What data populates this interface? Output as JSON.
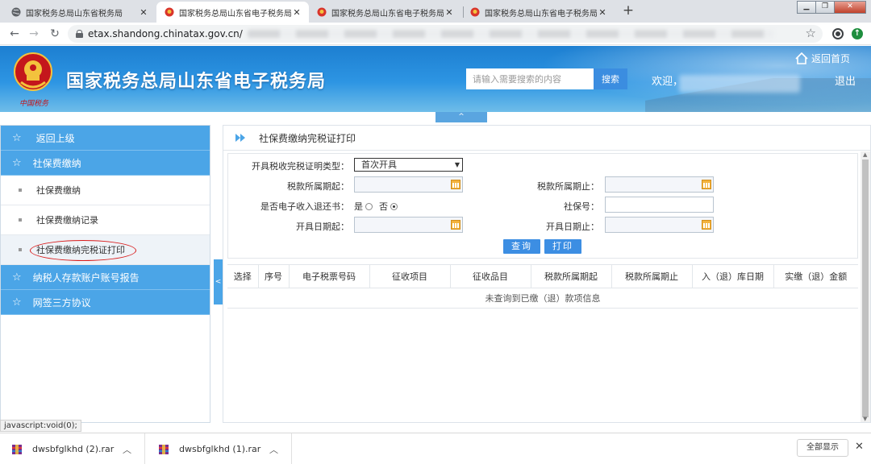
{
  "browser": {
    "tabs": [
      {
        "title": "国家税务总局山东省税务局",
        "active": false
      },
      {
        "title": "国家税务总局山东省电子税务局",
        "active": true
      },
      {
        "title": "国家税务总局山东省电子税务局",
        "active": false
      },
      {
        "title": "国家税务总局山东省电子税务局",
        "active": false
      }
    ],
    "url": "etax.shandong.chinatax.gov.cn/",
    "status_text": "javascript:void(0);"
  },
  "header": {
    "site_title": "国家税务总局山东省电子税务局",
    "emblem_text": "中国税务",
    "search_placeholder": "请输入需要搜索的内容",
    "search_button": "搜索",
    "welcome": "欢迎，",
    "home_link": "返回首页",
    "logout": "退出",
    "collapse_arrow": "^"
  },
  "sidebar": {
    "back": "返回上级",
    "groups": [
      {
        "label": "社保费缴纳",
        "items": [
          "社保费缴纳",
          "社保费缴纳记录",
          "社保费缴纳完税证打印"
        ]
      },
      {
        "label": "纳税人存款账户账号报告"
      },
      {
        "label": "网签三方协议"
      }
    ],
    "selected_item": "社保费缴纳完税证打印",
    "toggle_arrow": "<"
  },
  "main": {
    "page_title": "社保费缴纳完税证打印",
    "form": {
      "cert_type_label": "开具税收完税证明类型：",
      "cert_type_value": "首次开具",
      "tax_period_start_label": "税款所属期起：",
      "tax_period_end_label": "税款所属期止：",
      "e_refund_label": "是否电子收入退还书：",
      "yes_label": "是",
      "no_label": "否",
      "e_refund_selected": "否",
      "social_security_no_label": "社保号：",
      "issue_date_start_label": "开具日期起：",
      "issue_date_end_label": "开具日期止：",
      "query_button": "查询",
      "print_button": "打印"
    },
    "table": {
      "columns": [
        "选择",
        "序号",
        "电子税票号码",
        "征收项目",
        "征收品目",
        "税款所属期起",
        "税款所属期止",
        "入（退）库日期",
        "实缴（退）金额"
      ],
      "empty_message": "未查询到已缴（退）款项信息"
    }
  },
  "downloads": {
    "items": [
      {
        "name": "dwsbfglkhd (2).rar"
      },
      {
        "name": "dwsbfglkhd (1).rar"
      }
    ],
    "show_all": "全部显示"
  },
  "colors": {
    "accent": "#4ba5e7",
    "button": "#3c8ee3",
    "banner_top": "#1d7fd1",
    "banner_bottom": "#6fbde9",
    "circle_annotation": "#d81b1b"
  }
}
